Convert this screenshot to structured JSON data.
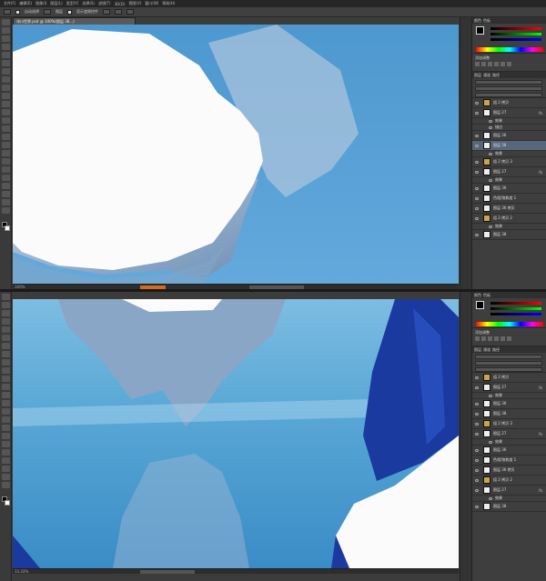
{
  "top_window": {
    "zoom": "100%",
    "menu": [
      "文件(F)",
      "编辑(E)",
      "图像(I)",
      "图层(L)",
      "类型(Y)",
      "选择(S)",
      "滤镜(T)",
      "3D(D)",
      "视图(V)",
      "窗口(W)",
      "帮助(H)"
    ],
    "options": [
      "自动选择",
      "图层",
      "显示变换控件"
    ],
    "doc_tab": "冰川世界.psd @ 100%(图层 38...)",
    "panel_tabs": [
      "颜色",
      "色板"
    ],
    "adj_tabs": [
      "调整",
      "样式"
    ],
    "adj_label": "添加调整",
    "layer_tabs": [
      "图层",
      "通道",
      "路径"
    ],
    "layers": [
      {
        "name": "组 2 拷贝",
        "kind": "group"
      },
      {
        "name": "图层 27",
        "kind": "layer",
        "fx": "fx"
      },
      {
        "name": "效果",
        "kind": "sub"
      },
      {
        "name": "描边",
        "kind": "sub"
      },
      {
        "name": "图层 36",
        "kind": "layer"
      },
      {
        "name": "图层 38",
        "kind": "layer",
        "selected": true
      },
      {
        "name": "效果",
        "kind": "sub"
      },
      {
        "name": "组 2 拷贝 3",
        "kind": "group"
      },
      {
        "name": "图层 27",
        "kind": "layer",
        "fx": "fx"
      },
      {
        "name": "效果",
        "kind": "sub"
      },
      {
        "name": "图层 36",
        "kind": "layer"
      },
      {
        "name": "色相/饱和度 1",
        "kind": "layer"
      },
      {
        "name": "图层 36 拷贝",
        "kind": "layer"
      },
      {
        "name": "组 2 拷贝 2",
        "kind": "group"
      },
      {
        "name": "效果",
        "kind": "sub"
      },
      {
        "name": "图层 38",
        "kind": "layer"
      }
    ]
  },
  "bottom_window": {
    "zoom": "33.33%",
    "layers": [
      {
        "name": "组 2 拷贝",
        "kind": "group"
      },
      {
        "name": "图层 27",
        "kind": "layer",
        "fx": "fx"
      },
      {
        "name": "效果",
        "kind": "sub"
      },
      {
        "name": "图层 36",
        "kind": "layer"
      },
      {
        "name": "图层 38",
        "kind": "layer"
      },
      {
        "name": "组 2 拷贝 3",
        "kind": "group"
      },
      {
        "name": "图层 27",
        "kind": "layer",
        "fx": "fx"
      },
      {
        "name": "效果",
        "kind": "sub"
      },
      {
        "name": "图层 36",
        "kind": "layer"
      },
      {
        "name": "色相/饱和度 1",
        "kind": "layer"
      },
      {
        "name": "图层 36 拷贝",
        "kind": "layer"
      },
      {
        "name": "组 2 拷贝 2",
        "kind": "group"
      },
      {
        "name": "图层 27",
        "kind": "layer",
        "fx": "fx"
      },
      {
        "name": "效果",
        "kind": "sub"
      },
      {
        "name": "图层 38",
        "kind": "layer"
      }
    ]
  },
  "colors": {
    "canvas_blue": "#5aa0d0",
    "ice_light": "#d8e6f2",
    "sea_deep": "#2f7fb8",
    "cloth_blue": "#1a3aa0",
    "selection": "#56677a",
    "accent_orange": "#d36b1f"
  }
}
